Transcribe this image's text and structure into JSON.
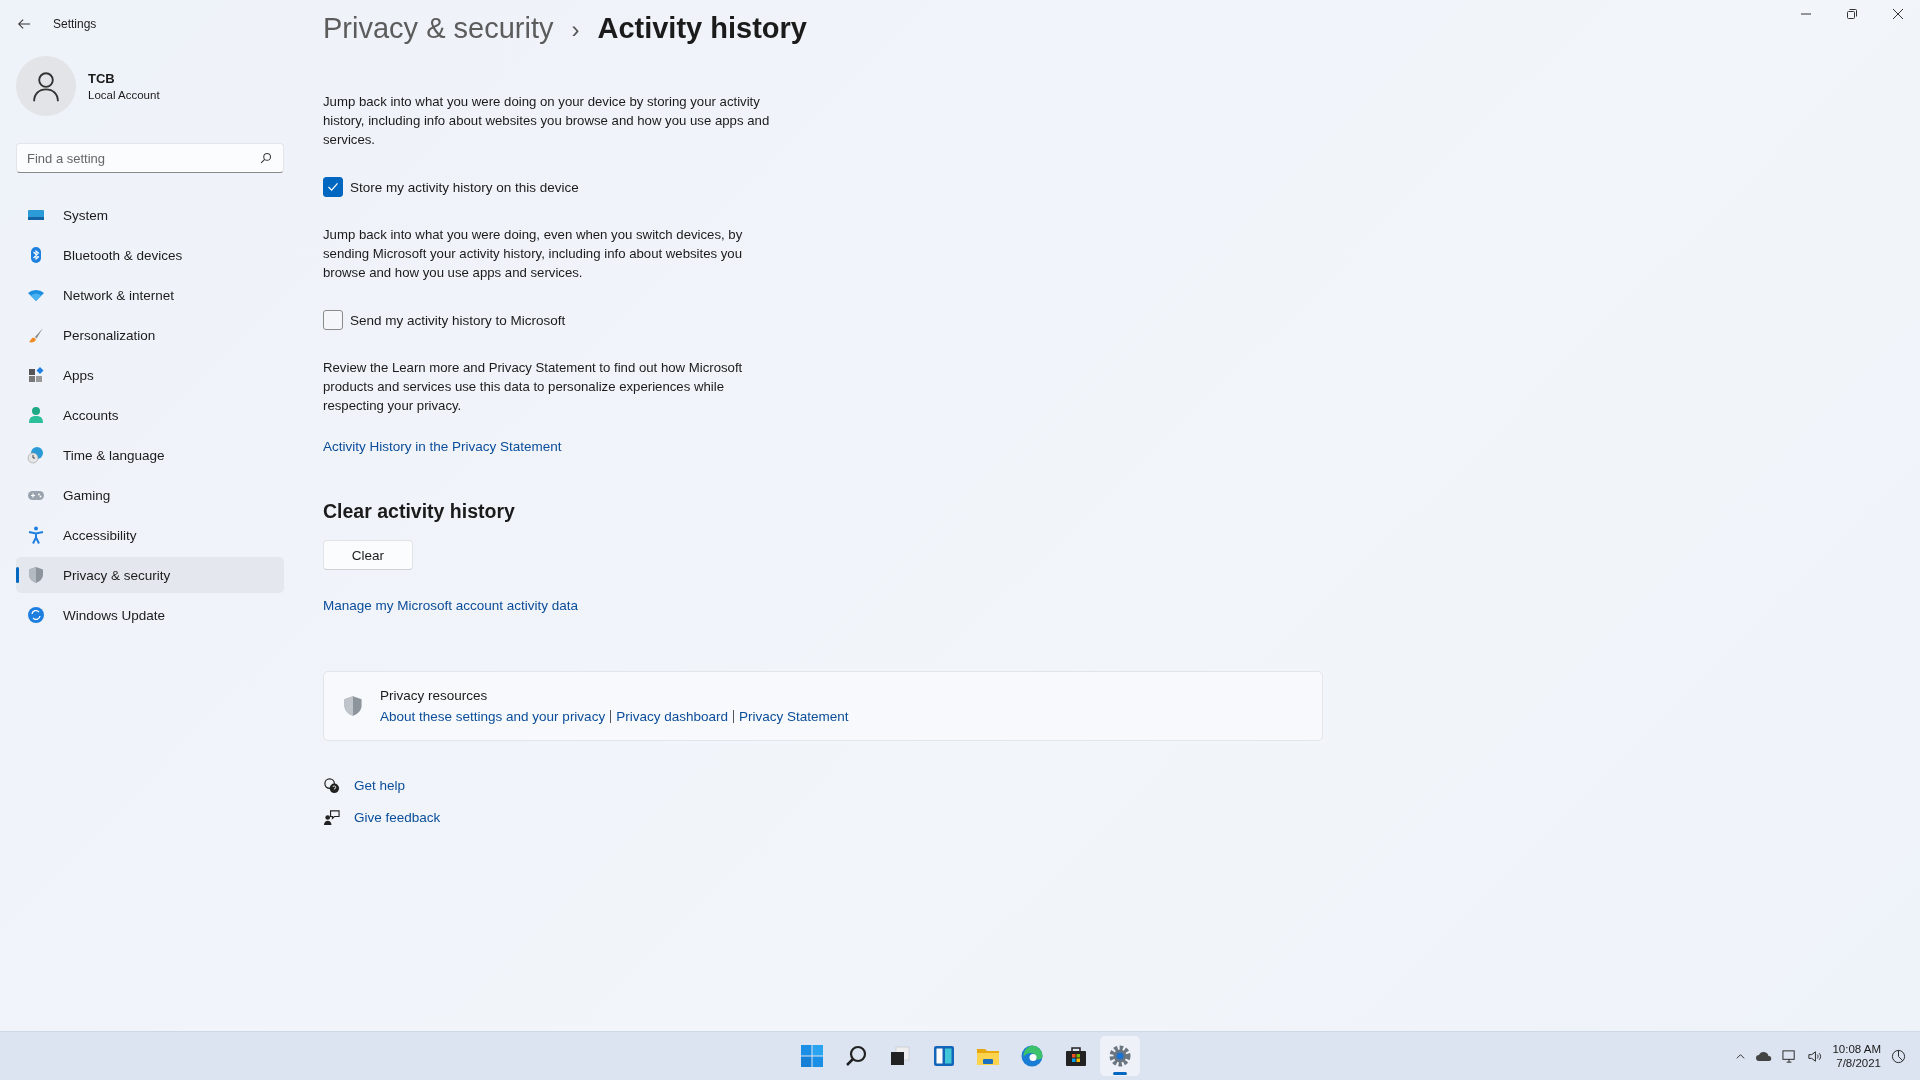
{
  "window": {
    "title": "Settings"
  },
  "account": {
    "name": "TCB",
    "type": "Local Account"
  },
  "search": {
    "placeholder": "Find a setting"
  },
  "nav": [
    {
      "label": "System",
      "selected": false
    },
    {
      "label": "Bluetooth & devices",
      "selected": false
    },
    {
      "label": "Network & internet",
      "selected": false
    },
    {
      "label": "Personalization",
      "selected": false
    },
    {
      "label": "Apps",
      "selected": false
    },
    {
      "label": "Accounts",
      "selected": false
    },
    {
      "label": "Time & language",
      "selected": false
    },
    {
      "label": "Gaming",
      "selected": false
    },
    {
      "label": "Accessibility",
      "selected": false
    },
    {
      "label": "Privacy & security",
      "selected": true
    },
    {
      "label": "Windows Update",
      "selected": false
    }
  ],
  "breadcrumb": {
    "parent": "Privacy & security",
    "separator": "›",
    "current": "Activity history"
  },
  "settings": [
    {
      "kind": "paragraph",
      "text": "Jump back into what you were doing on your device by storing your activity history, including info about websites you browse and how you use apps and services."
    },
    {
      "kind": "checkbox",
      "label": "Store my activity history on this device",
      "checked": true
    },
    {
      "kind": "paragraph",
      "text": "Jump back into what you were doing, even when you switch devices, by sending Microsoft your activity history, including info about websites you browse and how you use apps and services."
    },
    {
      "kind": "checkbox",
      "label": "Send my activity history to Microsoft",
      "checked": false
    },
    {
      "kind": "paragraph",
      "text": "Review the Learn more and Privacy Statement to find out how Microsoft products and services use this data to personalize experiences while respecting your privacy."
    },
    {
      "kind": "link",
      "text": "Activity History in the Privacy Statement"
    }
  ],
  "clear_section": {
    "heading": "Clear activity history",
    "button": "Clear",
    "link": "Manage my Microsoft account activity data"
  },
  "privacy_resources": {
    "title": "Privacy resources",
    "links": [
      "About these settings and your privacy",
      "Privacy dashboard",
      "Privacy Statement"
    ]
  },
  "help_links": [
    "Get help",
    "Give feedback"
  ],
  "taskbar": {
    "apps": [
      {
        "selected": false
      },
      {
        "selected": false
      },
      {
        "selected": false
      },
      {
        "selected": false
      },
      {
        "selected": false
      },
      {
        "selected": false
      },
      {
        "selected": false
      },
      {
        "selected": true
      }
    ]
  },
  "tray": {
    "time": "10:08 AM",
    "date": "7/8/2021"
  }
}
